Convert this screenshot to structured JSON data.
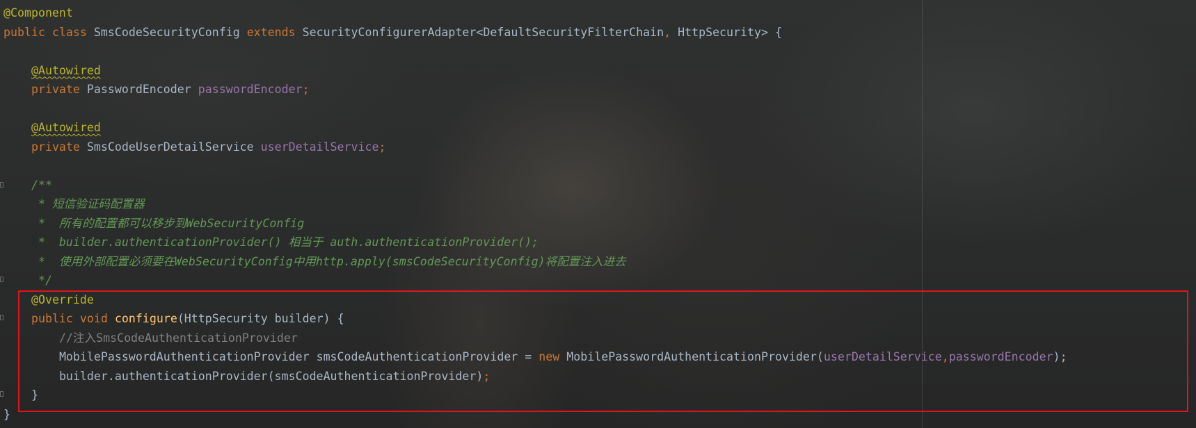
{
  "editor": {
    "lines": [
      {
        "indent": "",
        "tokens": [
          {
            "t": "@Component",
            "c": "ann"
          }
        ]
      },
      {
        "indent": "",
        "tokens": [
          {
            "t": "public",
            "c": "kw"
          },
          {
            "t": " ",
            "c": "plain"
          },
          {
            "t": "class",
            "c": "kw"
          },
          {
            "t": " SmsCodeSecurityConfig ",
            "c": "plain"
          },
          {
            "t": "extends",
            "c": "kw"
          },
          {
            "t": " SecurityConfigurerAdapter<DefaultSecurityFilterChain",
            "c": "plain"
          },
          {
            "t": ",",
            "c": "kw"
          },
          {
            "t": " HttpSecurity> {",
            "c": "plain"
          }
        ]
      },
      {
        "indent": "",
        "tokens": []
      },
      {
        "indent": "    ",
        "tokens": [
          {
            "t": "@Autowired",
            "c": "ann squiggle"
          }
        ]
      },
      {
        "indent": "    ",
        "tokens": [
          {
            "t": "private",
            "c": "kw"
          },
          {
            "t": " PasswordEncoder ",
            "c": "plain"
          },
          {
            "t": "passwordEncoder",
            "c": "field"
          },
          {
            "t": ";",
            "c": "kw"
          }
        ]
      },
      {
        "indent": "",
        "tokens": []
      },
      {
        "indent": "    ",
        "tokens": [
          {
            "t": "@Autowired",
            "c": "ann squiggle"
          }
        ]
      },
      {
        "indent": "    ",
        "tokens": [
          {
            "t": "private",
            "c": "kw"
          },
          {
            "t": " SmsCodeUserDetailService ",
            "c": "plain"
          },
          {
            "t": "userDetailService",
            "c": "field"
          },
          {
            "t": ";",
            "c": "kw"
          }
        ]
      },
      {
        "indent": "",
        "tokens": []
      },
      {
        "indent": "    ",
        "tokens": [
          {
            "t": "/**",
            "c": "comment-doc"
          }
        ]
      },
      {
        "indent": "     ",
        "tokens": [
          {
            "t": "* 短信验证码配置器",
            "c": "comment-doc"
          }
        ]
      },
      {
        "indent": "     ",
        "tokens": [
          {
            "t": "*  所有的配置都可以移步到WebSecurityConfig",
            "c": "comment-doc"
          }
        ]
      },
      {
        "indent": "     ",
        "tokens": [
          {
            "t": "*  builder.authenticationProvider() 相当于 auth.authenticationProvider();",
            "c": "comment-doc"
          }
        ]
      },
      {
        "indent": "     ",
        "tokens": [
          {
            "t": "*  使用外部配置必须要在WebSecurityConfig中用http.apply(smsCodeSecurityConfig)将配置注入进去",
            "c": "comment-doc"
          }
        ]
      },
      {
        "indent": "     ",
        "tokens": [
          {
            "t": "*/",
            "c": "comment-doc"
          }
        ]
      },
      {
        "indent": "    ",
        "tokens": [
          {
            "t": "@Override",
            "c": "ann"
          }
        ]
      },
      {
        "indent": "    ",
        "tokens": [
          {
            "t": "public",
            "c": "kw"
          },
          {
            "t": " ",
            "c": "plain"
          },
          {
            "t": "void",
            "c": "kw"
          },
          {
            "t": " ",
            "c": "plain"
          },
          {
            "t": "configure",
            "c": "method-decl"
          },
          {
            "t": "(HttpSecurity builder) {",
            "c": "plain"
          }
        ]
      },
      {
        "indent": "        ",
        "tokens": [
          {
            "t": "//注入SmsCodeAuthenticationProvider",
            "c": "comment-line"
          }
        ]
      },
      {
        "indent": "        ",
        "tokens": [
          {
            "t": "MobilePasswordAuthenticationProvider smsCodeAuthenticationProvider = ",
            "c": "plain"
          },
          {
            "t": "new",
            "c": "kw"
          },
          {
            "t": " MobilePasswordAuthenticationProvider(",
            "c": "plain"
          },
          {
            "t": "userDetailService",
            "c": "field"
          },
          {
            "t": ",",
            "c": "kw"
          },
          {
            "t": "passwordEncoder",
            "c": "field"
          },
          {
            "t": ");",
            "c": "plain"
          }
        ]
      },
      {
        "indent": "        ",
        "tokens": [
          {
            "t": "builder.authenticationProvider(smsCodeAuthenticationProvider)",
            "c": "plain"
          },
          {
            "t": ";",
            "c": "kw"
          }
        ]
      },
      {
        "indent": "    ",
        "tokens": [
          {
            "t": "}",
            "c": "plain"
          }
        ]
      },
      {
        "indent": "",
        "tokens": [
          {
            "t": "}",
            "c": "plain"
          }
        ]
      }
    ]
  },
  "colors": {
    "background": "#2b2b2b",
    "keyword": "#cc7832",
    "annotation": "#bbb529",
    "field": "#9876aa",
    "method_declaration": "#ffc66d",
    "doc_comment": "#629755",
    "line_comment": "#808080",
    "plain_text": "#a9b7c6",
    "highlight_box": "#e0141e"
  }
}
